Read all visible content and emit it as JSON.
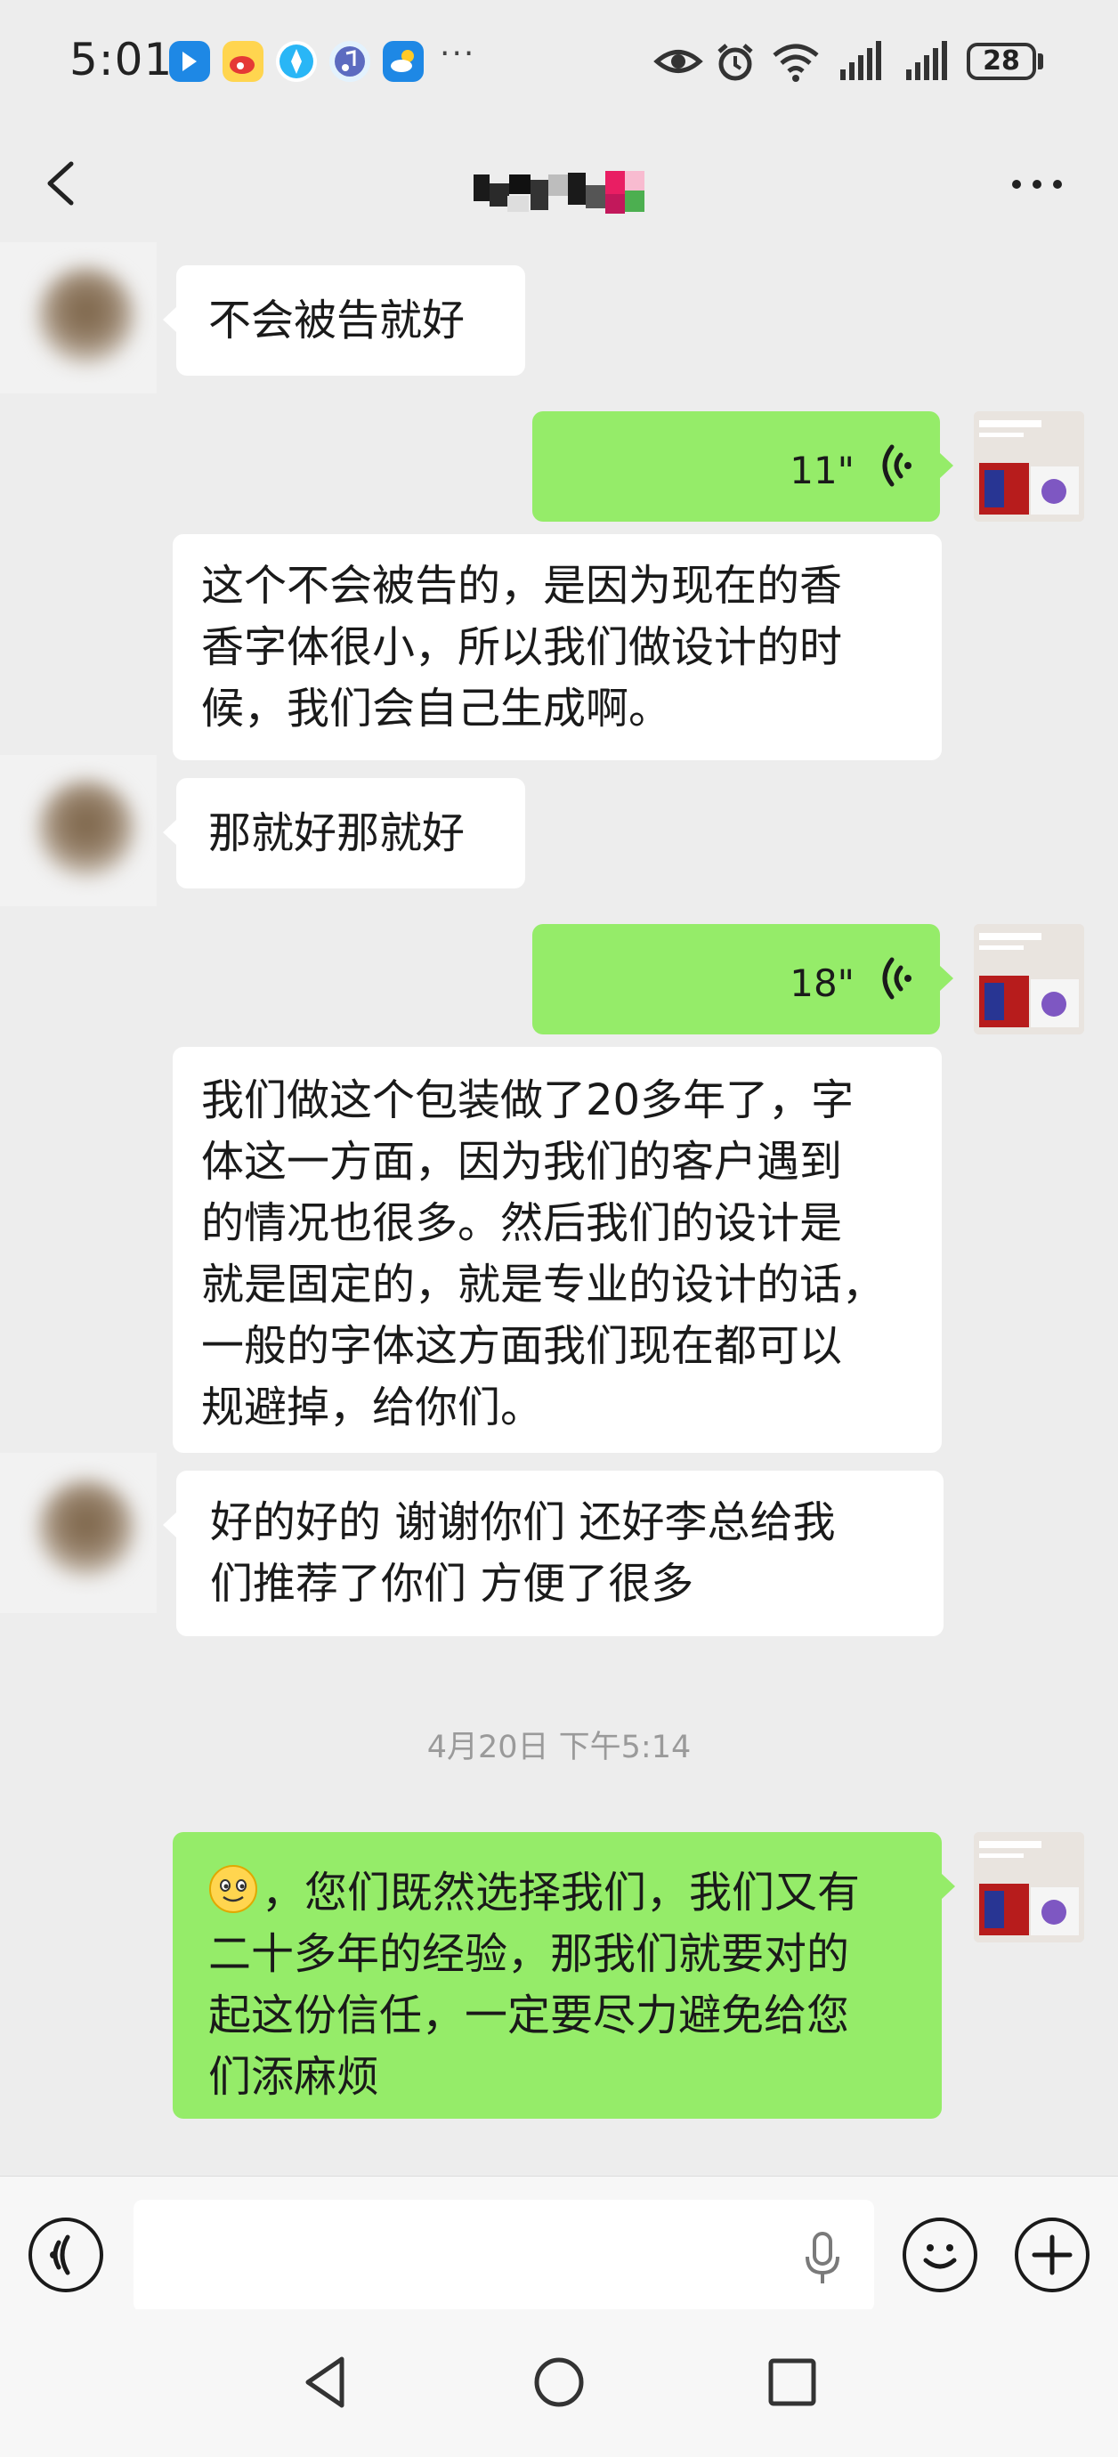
{
  "status_bar": {
    "time": "5:01",
    "app_icons": [
      "bluetooth-app-icon",
      "weibo-icon",
      "browser-icon",
      "music-icon",
      "weather-icon"
    ],
    "overflow": "···",
    "battery": "28"
  },
  "header": {
    "title_hidden": true,
    "back_icon": "chevron-left-icon",
    "more_icon": "more-icon"
  },
  "colors": {
    "background": "#ededed",
    "incoming_bubble": "#ffffff",
    "outgoing_bubble": "#95ec69",
    "timestamp": "#9a9a9a"
  },
  "messages": [
    {
      "side": "left",
      "type": "text",
      "text": "不会被告就好"
    },
    {
      "side": "right",
      "type": "voice",
      "duration": "11\""
    },
    {
      "side": "transcript",
      "type": "text",
      "lines": [
        "这个不会被告的，是因为现在的香",
        "香字体很小，所以我们做设计的时",
        "候，我们会自己生成啊。"
      ]
    },
    {
      "side": "left",
      "type": "text",
      "text": "那就好那就好"
    },
    {
      "side": "right",
      "type": "voice",
      "duration": "18\""
    },
    {
      "side": "transcript",
      "type": "text",
      "lines": [
        "我们做这个包装做了20多年了，字",
        "体这一方面，因为我们的客户遇到",
        "的情况也很多。然后我们的设计是",
        "就是固定的，就是专业的设计的话，",
        "一般的字体这方面我们现在都可以",
        "规避掉，给你们。"
      ]
    },
    {
      "side": "left",
      "type": "text",
      "lines": [
        "好的好的 谢谢你们 还好李总给我",
        "们推荐了你们 方便了很多"
      ]
    },
    {
      "side": "center",
      "type": "timestamp",
      "text": "4月20日 下午5:14"
    },
    {
      "side": "right",
      "type": "text",
      "emoji": "smile-emoji",
      "lines": [
        "，您们既然选择我们，我们又有",
        "二十多年的经验，那我们就要对的",
        "起这份信任，一定要尽力避免给您",
        "们添麻烦"
      ]
    }
  ],
  "input_bar": {
    "left_button": "voice-mode-icon",
    "field_icon": "microphone-icon",
    "emoji_button": "emoji-icon",
    "plus_button": "plus-icon"
  },
  "nav_bar": [
    "back-triangle-icon",
    "home-circle-icon",
    "recents-square-icon"
  ]
}
